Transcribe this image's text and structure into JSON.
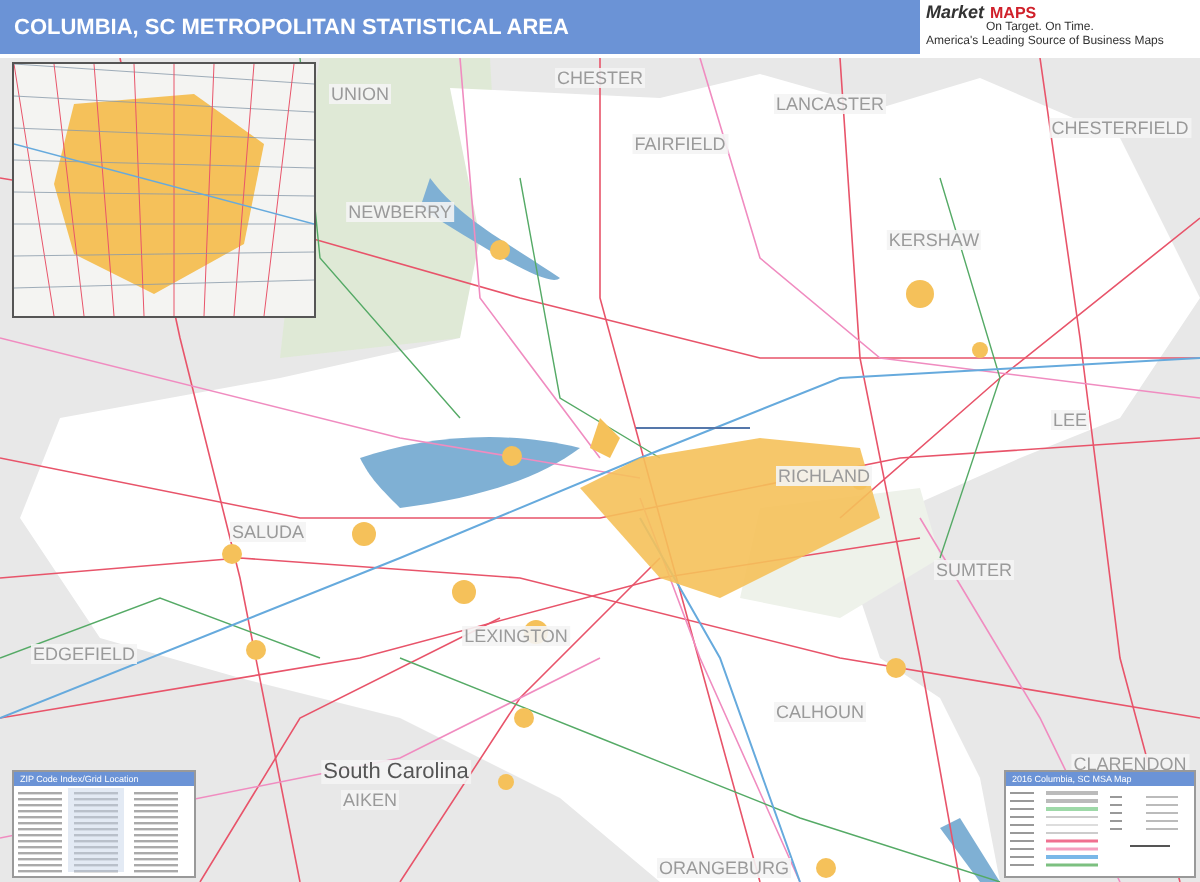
{
  "header": {
    "title": "COLUMBIA, SC METROPOLITAN STATISTICAL AREA"
  },
  "logo": {
    "name": "Market",
    "accent": "MAPS",
    "tagline": "On Target. On Time.",
    "slogan": "America's Leading Source of Business Maps"
  },
  "map": {
    "labels": [
      {
        "text": "UNION",
        "kind": "county"
      },
      {
        "text": "CHESTER",
        "kind": "county"
      },
      {
        "text": "FAIRFIELD",
        "kind": "county"
      },
      {
        "text": "LANCASTER",
        "kind": "county"
      },
      {
        "text": "CHESTERFIELD",
        "kind": "county"
      },
      {
        "text": "NEWBERRY",
        "kind": "county"
      },
      {
        "text": "KERSHAW",
        "kind": "county"
      },
      {
        "text": "LEE",
        "kind": "county"
      },
      {
        "text": "RICHLAND",
        "kind": "county"
      },
      {
        "text": "SALUDA",
        "kind": "county"
      },
      {
        "text": "SUMTER",
        "kind": "county"
      },
      {
        "text": "EDGEFIELD",
        "kind": "county"
      },
      {
        "text": "LEXINGTON",
        "kind": "county"
      },
      {
        "text": "CALHOUN",
        "kind": "county"
      },
      {
        "text": "CLARENDON",
        "kind": "county"
      },
      {
        "text": "South Carolina",
        "kind": "state"
      },
      {
        "text": "AIKEN",
        "kind": "county"
      },
      {
        "text": "ORANGEBURG",
        "kind": "county"
      }
    ]
  },
  "index_panel": {
    "title": "ZIP Code Index/Grid Location"
  },
  "legend": {
    "title": "2016 Columbia, SC MSA Map"
  }
}
